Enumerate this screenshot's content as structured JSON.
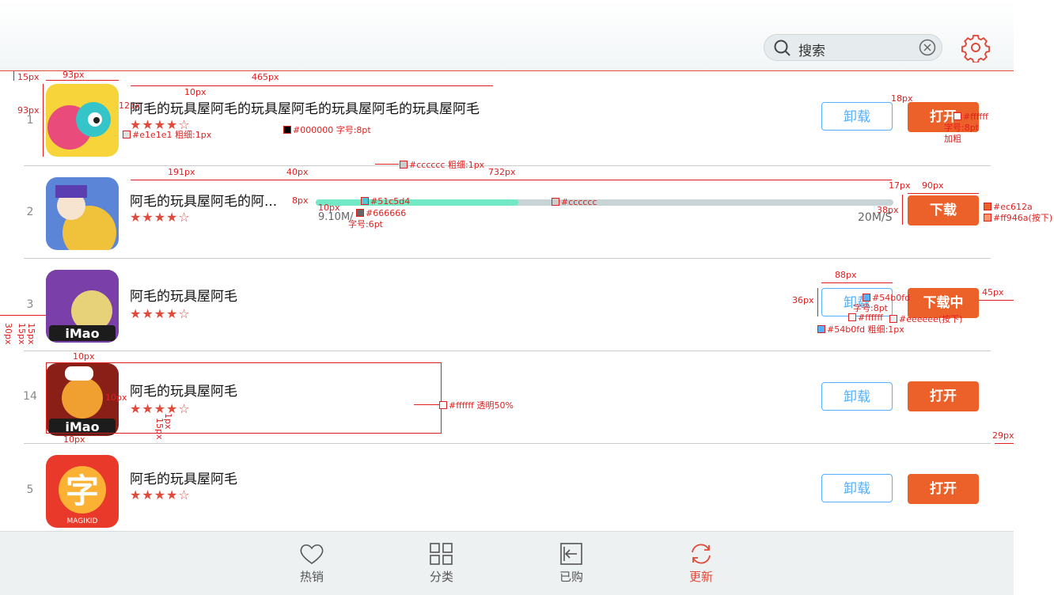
{
  "search": {
    "placeholder": "搜索"
  },
  "apps": [
    {
      "rank": "1",
      "name": "阿毛的玩具屋阿毛的玩具屋阿毛的玩具屋阿毛的玩具屋阿毛",
      "stars": "★★★★☆",
      "secondary": "卸载",
      "primary": "打开",
      "icon_color": "#f6d43a"
    },
    {
      "rank": "2",
      "name": "阿毛的玩具屋阿毛的阿...",
      "stars": "★★★★☆",
      "primary": "下载",
      "icon_color": "#5b86d8",
      "download": {
        "progress": 0.35,
        "size": "9.10M/",
        "speed": "20M/S"
      }
    },
    {
      "rank": "3",
      "name": "阿毛的玩具屋阿毛",
      "stars": "★★★★☆",
      "secondary": "卸载",
      "primary": "下载中",
      "icon_color": "#3d8a4a"
    },
    {
      "rank": "14",
      "name": "阿毛的玩具屋阿毛",
      "stars": "★★★★☆",
      "secondary": "卸载",
      "primary": "打开",
      "icon_color": "#8a1f17"
    },
    {
      "rank": "5",
      "name": "阿毛的玩具屋阿毛",
      "stars": "★★★★☆",
      "secondary": "卸载",
      "primary": "打开",
      "icon_color": "#e8392b"
    }
  ],
  "tabs": [
    {
      "label": "热销",
      "icon": "heart-icon"
    },
    {
      "label": "分类",
      "icon": "grid-icon"
    },
    {
      "label": "已购",
      "icon": "purchased-icon"
    },
    {
      "label": "更新",
      "icon": "refresh-icon",
      "active": true
    }
  ],
  "colors": {
    "accent": "#ec612a",
    "accent_pressed": "#ff946a",
    "outline": "#54b0fd",
    "progress": "#51c5d4",
    "divider": "#cccccc"
  },
  "annotations": {
    "a1": "15px",
    "a2": "93px",
    "a3": "465px",
    "a4": "10px",
    "a5": "93px",
    "a6": "12px",
    "a7": "#e1e1e1 粗细:1px",
    "a8": "#000000 字号:8pt",
    "a9": "18px",
    "a10": "#ffffff",
    "a11": "字号:8pt",
    "a12": "加粗",
    "a13": "#cccccc 粗细:1px",
    "a14": "191px",
    "a15": "40px",
    "a16": "732px",
    "a17": "17px",
    "a18": "90px",
    "a19": "8px",
    "a20": "10px",
    "a21": "#51c5d4",
    "a22": "#666666",
    "a23": "字号:6pt",
    "a24": "#cccccc",
    "a25": "38px",
    "a26": "#ec612a",
    "a27": "#ff946a(按下)",
    "a28": "88px",
    "a29": "36px",
    "a30": "#54b0fd",
    "a31": "字号:8pt",
    "a32": "#ffffff",
    "a33": "#eeeeee(按下)",
    "a34": "#54b0fd 粗细:1px",
    "a35": "45px",
    "a36": "30px",
    "a37": "15px",
    "a38": "15px",
    "a39": "10px",
    "a40": "10px",
    "a41": "#ffffff 透明50%",
    "a42": "1px",
    "a43": "15px",
    "a44": "10px",
    "a45": "29px"
  }
}
